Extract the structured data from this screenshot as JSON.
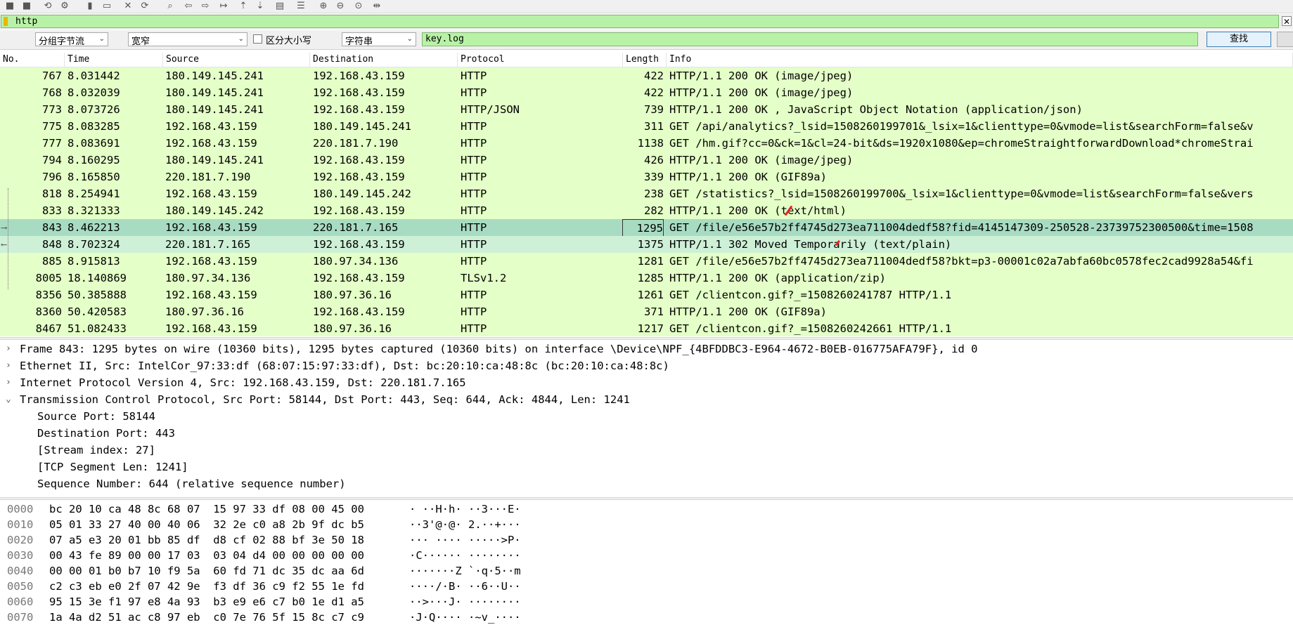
{
  "colors": {
    "filter_bg": "#b8f2a6",
    "row_bg": "#e4ffc7",
    "row_selected_bg": "#a8dcc2",
    "row_related_bg": "#cdf0d6"
  },
  "toolbar": {
    "icons": [
      "stop-icon",
      "restart-icon",
      "reload-icon",
      "options-icon",
      "open-icon",
      "save-icon",
      "close-icon",
      "refresh-icon",
      "find-icon",
      "back-icon",
      "forward-icon",
      "goto-icon",
      "top-icon",
      "bottom-icon",
      "autoscroll-icon",
      "colorize-icon",
      "zoom-in-icon",
      "zoom-out-icon",
      "zoom-normal-icon",
      "resize-columns-icon"
    ]
  },
  "filter": {
    "value": "http"
  },
  "search": {
    "scope": "分组字节流",
    "charset": "宽窄",
    "case_label": "区分大小写",
    "type": "字符串",
    "value": "key.log",
    "find_label": "查找"
  },
  "columns": [
    "No.",
    "Time",
    "Source",
    "Destination",
    "Protocol",
    "Length",
    "Info"
  ],
  "packets": [
    {
      "no": "767",
      "time": "8.031442",
      "src": "180.149.145.241",
      "dst": "192.168.43.159",
      "proto": "HTTP",
      "len": "422",
      "info": "HTTP/1.1 200 OK  (image/jpeg)"
    },
    {
      "no": "768",
      "time": "8.032039",
      "src": "180.149.145.241",
      "dst": "192.168.43.159",
      "proto": "HTTP",
      "len": "422",
      "info": "HTTP/1.1 200 OK  (image/jpeg)"
    },
    {
      "no": "773",
      "time": "8.073726",
      "src": "180.149.145.241",
      "dst": "192.168.43.159",
      "proto": "HTTP/JSON",
      "len": "739",
      "info": "HTTP/1.1 200 OK , JavaScript Object Notation (application/json)"
    },
    {
      "no": "775",
      "time": "8.083285",
      "src": "192.168.43.159",
      "dst": "180.149.145.241",
      "proto": "HTTP",
      "len": "311",
      "info": "GET /api/analytics?_lsid=1508260199701&_lsix=1&clienttype=0&vmode=list&searchForm=false&v"
    },
    {
      "no": "777",
      "time": "8.083691",
      "src": "192.168.43.159",
      "dst": "220.181.7.190",
      "proto": "HTTP",
      "len": "1138",
      "info": "GET /hm.gif?cc=0&ck=1&cl=24-bit&ds=1920x1080&ep=chromeStraightforwardDownload*chromeStrai"
    },
    {
      "no": "794",
      "time": "8.160295",
      "src": "180.149.145.241",
      "dst": "192.168.43.159",
      "proto": "HTTP",
      "len": "426",
      "info": "HTTP/1.1 200 OK  (image/jpeg)"
    },
    {
      "no": "796",
      "time": "8.165850",
      "src": "220.181.7.190",
      "dst": "192.168.43.159",
      "proto": "HTTP",
      "len": "339",
      "info": "HTTP/1.1 200 OK  (GIF89a)"
    },
    {
      "no": "818",
      "time": "8.254941",
      "src": "192.168.43.159",
      "dst": "180.149.145.242",
      "proto": "HTTP",
      "len": "238",
      "info": "GET /statistics?_lsid=1508260199700&_lsix=1&clienttype=0&vmode=list&searchForm=false&vers"
    },
    {
      "no": "833",
      "time": "8.321333",
      "src": "180.149.145.242",
      "dst": "192.168.43.159",
      "proto": "HTTP",
      "len": "282",
      "info": "HTTP/1.1 200 OK  (text/html)"
    },
    {
      "no": "843",
      "time": "8.462213",
      "src": "192.168.43.159",
      "dst": "220.181.7.165",
      "proto": "HTTP",
      "len": "1295",
      "info": "GET /file/e56e57b2ff4745d273ea711004dedf58?fid=4145147309-250528-23739752300500&time=1508"
    },
    {
      "no": "848",
      "time": "8.702324",
      "src": "220.181.7.165",
      "dst": "192.168.43.159",
      "proto": "HTTP",
      "len": "1375",
      "info": "HTTP/1.1 302 Moved Temporarily  (text/plain)"
    },
    {
      "no": "885",
      "time": "8.915813",
      "src": "192.168.43.159",
      "dst": "180.97.34.136",
      "proto": "HTTP",
      "len": "1281",
      "info": "GET /file/e56e57b2ff4745d273ea711004dedf58?bkt=p3-00001c02a7abfa60bc0578fec2cad9928a54&fi"
    },
    {
      "no": "8005",
      "time": "18.140869",
      "src": "180.97.34.136",
      "dst": "192.168.43.159",
      "proto": "TLSv1.2",
      "len": "1285",
      "info": "HTTP/1.1 200 OK  (application/zip)"
    },
    {
      "no": "8356",
      "time": "50.385888",
      "src": "192.168.43.159",
      "dst": "180.97.36.16",
      "proto": "HTTP",
      "len": "1261",
      "info": "GET /clientcon.gif?_=1508260241787 HTTP/1.1"
    },
    {
      "no": "8360",
      "time": "50.420583",
      "src": "180.97.36.16",
      "dst": "192.168.43.159",
      "proto": "HTTP",
      "len": "371",
      "info": "HTTP/1.1 200 OK  (GIF89a)"
    },
    {
      "no": "8467",
      "time": "51.082433",
      "src": "192.168.43.159",
      "dst": "180.97.36.16",
      "proto": "HTTP",
      "len": "1217",
      "info": "GET /clientcon.gif?_=1508260242661 HTTP/1.1"
    }
  ],
  "details": [
    {
      "text": "Frame 843: 1295 bytes on wire (10360 bits), 1295 bytes captured (10360 bits) on interface \\Device\\NPF_{4BFDDBC3-E964-4672-B0EB-016775AFA79F}, id 0",
      "toggle": "›"
    },
    {
      "text": "Ethernet II, Src: IntelCor_97:33:df (68:07:15:97:33:df), Dst: bc:20:10:ca:48:8c (bc:20:10:ca:48:8c)",
      "toggle": "›"
    },
    {
      "text": "Internet Protocol Version 4, Src: 192.168.43.159, Dst: 220.181.7.165",
      "toggle": "›"
    },
    {
      "text": "Transmission Control Protocol, Src Port: 58144, Dst Port: 443, Seq: 644, Ack: 4844, Len: 1241",
      "toggle": "⌄"
    },
    {
      "text": "Source Port: 58144",
      "toggle": ""
    },
    {
      "text": "Destination Port: 443",
      "toggle": ""
    },
    {
      "text": "[Stream index: 27]",
      "toggle": ""
    },
    {
      "text": "[TCP Segment Len: 1241]",
      "toggle": ""
    },
    {
      "text": "Sequence Number: 644    (relative sequence number)",
      "toggle": ""
    }
  ],
  "bytes": [
    {
      "off": "0000",
      "hex": "bc 20 10 ca 48 8c 68 07  15 97 33 df 08 00 45 00",
      "ascii": "· ··H·h· ··3···E·"
    },
    {
      "off": "0010",
      "hex": "05 01 33 27 40 00 40 06  32 2e c0 a8 2b 9f dc b5",
      "ascii": "··3'@·@· 2.··+···"
    },
    {
      "off": "0020",
      "hex": "07 a5 e3 20 01 bb 85 df  d8 cf 02 88 bf 3e 50 18",
      "ascii": "··· ···· ·····>P·"
    },
    {
      "off": "0030",
      "hex": "00 43 fe 89 00 00 17 03  03 04 d4 00 00 00 00 00",
      "ascii": "·C······ ········"
    },
    {
      "off": "0040",
      "hex": "00 00 01 b0 b7 10 f9 5a  60 fd 71 dc 35 dc aa 6d",
      "ascii": "·······Z `·q·5··m"
    },
    {
      "off": "0050",
      "hex": "c2 c3 eb e0 2f 07 42 9e  f3 df 36 c9 f2 55 1e fd",
      "ascii": "····/·B· ··6··U··"
    },
    {
      "off": "0060",
      "hex": "95 15 3e f1 97 e8 4a 93  b3 e9 e6 c7 b0 1e d1 a5",
      "ascii": "··>···J· ········"
    },
    {
      "off": "0070",
      "hex": "1a 4a d2 51 ac c8 97 eb  c0 7e 76 5f 15 8c c7 c9",
      "ascii": "·J·Q···· ·~v_····"
    }
  ]
}
